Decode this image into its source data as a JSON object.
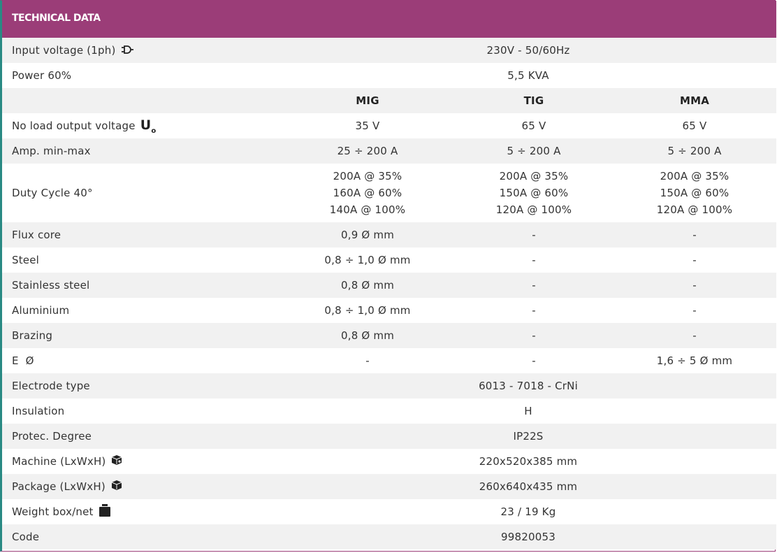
{
  "header": {
    "title": "TECHNICAL DATA"
  },
  "columns": {
    "mig": "MIG",
    "tig": "TIG",
    "mma": "MMA"
  },
  "rows": {
    "input_voltage": {
      "label": "Input voltage (1ph)",
      "icon": "plug-icon",
      "value": "230V - 50/60Hz"
    },
    "power": {
      "label": "Power 60%",
      "value": "5,5 KVA"
    },
    "no_load": {
      "label": "No load output voltage",
      "symbol": "U",
      "symbol_sub": "o",
      "mig": "35 V",
      "tig": "65 V",
      "mma": "65 V"
    },
    "amp": {
      "label": "Amp. min-max",
      "mig": "25 ÷ 200 A",
      "tig": "5 ÷ 200 A",
      "mma": "5 ÷ 200 A"
    },
    "duty": {
      "label": "Duty Cycle 40°",
      "mig": [
        "200A @ 35%",
        "160A @ 60%",
        "140A @ 100%"
      ],
      "tig": [
        "200A @ 35%",
        "150A @ 60%",
        "120A @ 100%"
      ],
      "mma": [
        "200A @ 35%",
        "150A @ 60%",
        "120A @ 100%"
      ]
    },
    "flux": {
      "label": "Flux core",
      "mig": "0,9 Ø mm",
      "tig": "-",
      "mma": "-"
    },
    "steel": {
      "label": "Steel",
      "mig": "0,8 ÷ 1,0 Ø mm",
      "tig": "-",
      "mma": "-"
    },
    "stainless": {
      "label": "Stainless steel",
      "mig": "0,8 Ø mm",
      "tig": "-",
      "mma": "-"
    },
    "aluminium": {
      "label": "Aluminium",
      "mig": "0,8 ÷ 1,0 Ø mm",
      "tig": "-",
      "mma": "-"
    },
    "brazing": {
      "label": "Brazing",
      "mig": "0,8 Ø mm",
      "tig": "-",
      "mma": "-"
    },
    "electrode_dia": {
      "label": "E  Ø",
      "mig": "-",
      "tig": "-",
      "mma": "1,6 ÷ 5 Ø mm"
    },
    "electrode_type": {
      "label": "Electrode type",
      "value": "6013 - 7018 - CrNi"
    },
    "insulation": {
      "label": "Insulation",
      "value": "H"
    },
    "protec": {
      "label": "Protec. Degree",
      "value": "IP22S"
    },
    "machine": {
      "label": "Machine (LxWxH)",
      "icon": "machine-box-icon",
      "value": "220x520x385 mm"
    },
    "package": {
      "label": "Package (LxWxH)",
      "icon": "package-box-icon",
      "value": "260x640x435 mm"
    },
    "weight": {
      "label": "Weight box/net",
      "icon": "weight-icon",
      "value": "23 / 19 Kg"
    },
    "code": {
      "label": "Code",
      "value": "99820053"
    }
  },
  "colors": {
    "header_bg": "#9b3d78",
    "row_alt": "#f1f1f1",
    "text": "#333333"
  }
}
